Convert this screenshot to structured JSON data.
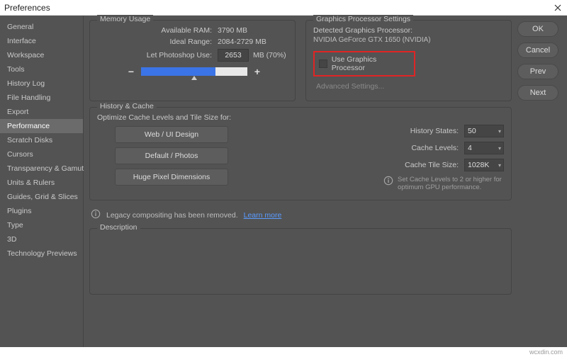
{
  "window": {
    "title": "Preferences"
  },
  "sidebar": {
    "items": [
      {
        "label": "General"
      },
      {
        "label": "Interface"
      },
      {
        "label": "Workspace"
      },
      {
        "label": "Tools"
      },
      {
        "label": "History Log"
      },
      {
        "label": "File Handling"
      },
      {
        "label": "Export"
      },
      {
        "label": "Performance"
      },
      {
        "label": "Scratch Disks"
      },
      {
        "label": "Cursors"
      },
      {
        "label": "Transparency & Gamut"
      },
      {
        "label": "Units & Rulers"
      },
      {
        "label": "Guides, Grid & Slices"
      },
      {
        "label": "Plugins"
      },
      {
        "label": "Type"
      },
      {
        "label": "3D"
      },
      {
        "label": "Technology Previews"
      }
    ],
    "selected_index": 7
  },
  "memory": {
    "legend": "Memory Usage",
    "available_label": "Available RAM:",
    "available_value": "3790 MB",
    "ideal_label": "Ideal Range:",
    "ideal_value": "2084-2729 MB",
    "let_use_label": "Let Photoshop Use:",
    "let_use_value": "2653",
    "let_use_suffix": "MB (70%)",
    "slider_percent": 70
  },
  "gpu": {
    "legend": "Graphics Processor Settings",
    "detected_label": "Detected Graphics Processor:",
    "detected_value": "NVIDIA GeForce GTX 1650 (NVIDIA)",
    "use_gpu_label": "Use Graphics Processor",
    "advanced_label": "Advanced Settings..."
  },
  "history": {
    "legend": "History & Cache",
    "optimize_label": "Optimize Cache Levels and Tile Size for:",
    "presets": [
      "Web / UI Design",
      "Default / Photos",
      "Huge Pixel Dimensions"
    ],
    "history_states_label": "History States:",
    "history_states_value": "50",
    "cache_levels_label": "Cache Levels:",
    "cache_levels_value": "4",
    "cache_tile_label": "Cache Tile Size:",
    "cache_tile_value": "1028K",
    "hint": "Set Cache Levels to 2 or higher for optimum GPU performance."
  },
  "legacy": {
    "text": "Legacy compositing has been removed.",
    "link": "Learn more"
  },
  "description": {
    "legend": "Description"
  },
  "buttons": {
    "ok": "OK",
    "cancel": "Cancel",
    "prev": "Prev",
    "next": "Next"
  },
  "footer": {
    "watermark": "wcxdin.com"
  }
}
